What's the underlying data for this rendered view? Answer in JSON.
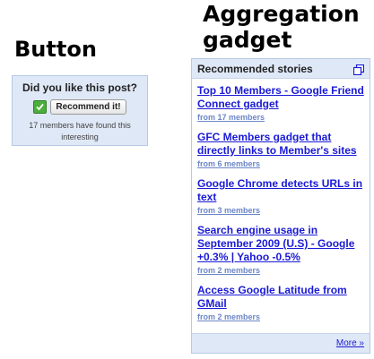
{
  "headings": {
    "button": "Button",
    "gadget": "Aggregation\ngadget"
  },
  "button_widget": {
    "question": "Did you like this post?",
    "button_label": "Recommend it!",
    "count_text": "17 members have found this interesting"
  },
  "gadget": {
    "title": "Recommended stories",
    "stories": [
      {
        "title": "Top 10 Members - Google Friend Connect gadget",
        "from": "from 17 members"
      },
      {
        "title": "GFC Members gadget that directly links to Member's sites",
        "from": "from 6 members"
      },
      {
        "title": "Google Chrome detects URLs in text",
        "from": "from 3 members"
      },
      {
        "title": "Search engine usage in September 2009 (U.S) - Google +0.3% | Yahoo -0.5%",
        "from": "from 2 members"
      },
      {
        "title": "Access Google Latitude from GMail",
        "from": "from 2 members"
      }
    ],
    "more_label": "More »"
  },
  "colors": {
    "panel_bg": "#dfe8f6",
    "link": "#1a1ad6",
    "meta_link": "#6b86c7",
    "check_green": "#4caf3c"
  }
}
